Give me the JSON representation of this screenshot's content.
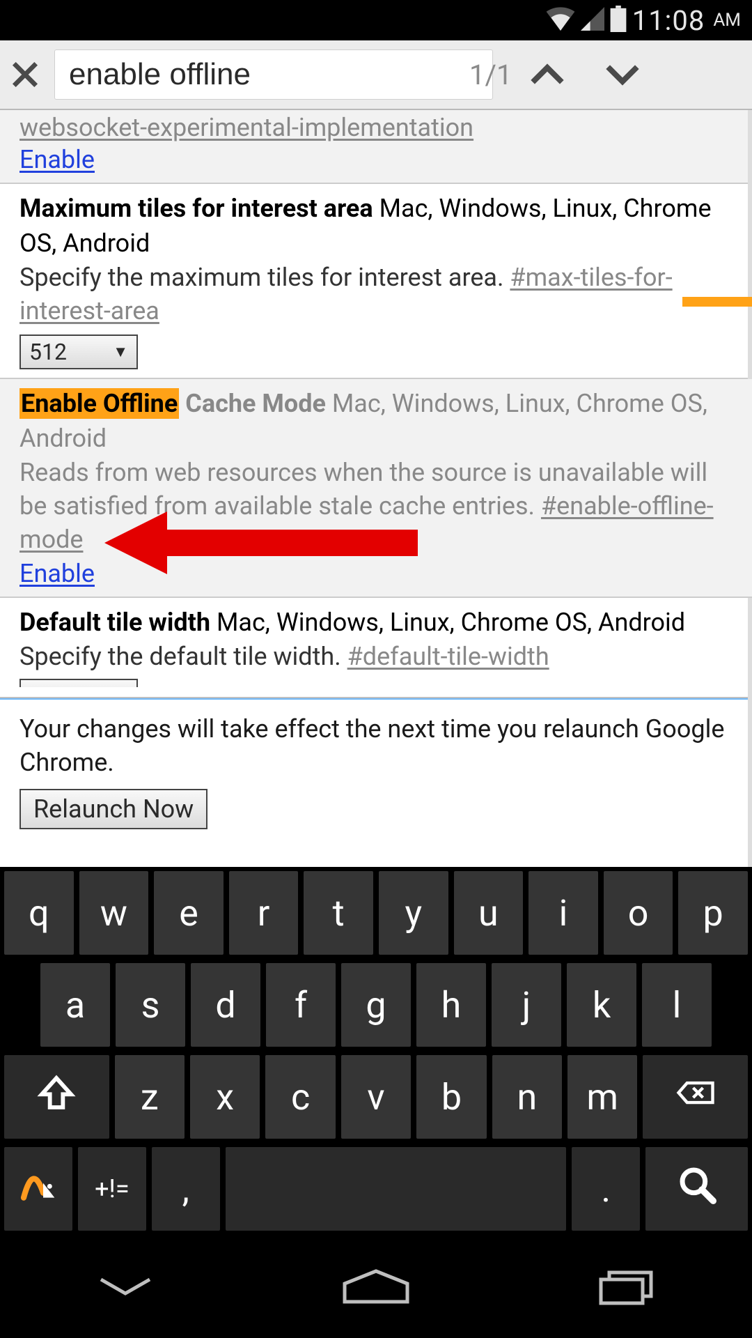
{
  "status": {
    "time": "11:08",
    "ampm": "AM"
  },
  "findbar": {
    "query": "enable offline",
    "count": "1/1"
  },
  "flags": {
    "websocket": {
      "hash": "websocket-experimental-implementation",
      "link": "Enable"
    },
    "maxtiles": {
      "title": "Maximum tiles for interest area",
      "platforms": "Mac, Windows, Linux, Chrome OS, Android",
      "desc": "Specify the maximum tiles for interest area. ",
      "hash": "#max-tiles-for-interest-area",
      "value": "512"
    },
    "offline": {
      "title_hl": "Enable Offline",
      "title_rest": " Cache Mode",
      "platforms": "Mac, Windows, Linux, Chrome OS, Android",
      "desc": "Reads from web resources when the source is unavailable will be satisfied from available stale cache entries. ",
      "hash": "#enable-offline-mode",
      "link": "Enable"
    },
    "tilewidth": {
      "title": "Default tile width",
      "platforms": "Mac, Windows, Linux, Chrome OS, Android",
      "desc": "Specify the default tile width. ",
      "hash": "#default-tile-width"
    }
  },
  "relaunch": {
    "text": "Your changes will take effect the next time you relaunch Google Chrome.",
    "button": "Relaunch Now"
  },
  "keyboard": {
    "row1": [
      "q",
      "w",
      "e",
      "r",
      "t",
      "y",
      "u",
      "i",
      "o",
      "p"
    ],
    "row2": [
      "a",
      "s",
      "d",
      "f",
      "g",
      "h",
      "j",
      "k",
      "l"
    ],
    "row3": [
      "z",
      "x",
      "c",
      "v",
      "b",
      "n",
      "m"
    ],
    "sym": "+!=",
    "comma": ",",
    "period": "."
  }
}
